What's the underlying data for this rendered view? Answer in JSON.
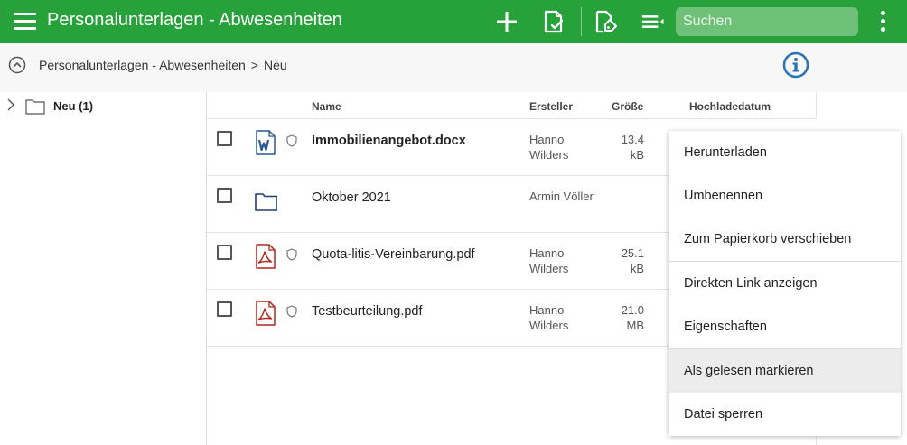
{
  "header": {
    "title": "Personalunterlagen - Abwesenheiten",
    "search_placeholder": "Suchen",
    "icons": [
      "menu-icon",
      "add-icon",
      "document-check-icon",
      "tag-edit-icon",
      "sort-list-icon",
      "more-vert-icon"
    ],
    "brand_color": "#27a13a"
  },
  "breadcrumb": {
    "root": "Personalunterlagen - Abwesenheiten",
    "separator": ">",
    "current": "Neu"
  },
  "tree": {
    "items": [
      {
        "label": "Neu (1)"
      }
    ]
  },
  "table": {
    "columns": {
      "name": "Name",
      "creator": "Ersteller",
      "size": "Größe",
      "uploaded": "Hochladedatum"
    },
    "rows": [
      {
        "type": "word-file-icon",
        "name": "Immobilienangebot.docx",
        "bold": true,
        "creator_first": "Hanno",
        "creator_last": "Wilders",
        "size_value": "13.4",
        "size_unit": "kB"
      },
      {
        "type": "folder-icon",
        "name": "Oktober 2021",
        "bold": false,
        "creator_first": "Armin Völler",
        "creator_last": "",
        "size_value": "",
        "size_unit": ""
      },
      {
        "type": "pdf-file-icon",
        "name": "Quota-litis-Vereinbarung.pdf",
        "bold": false,
        "creator_first": "Hanno",
        "creator_last": "Wilders",
        "size_value": "25.1",
        "size_unit": "kB"
      },
      {
        "type": "pdf-file-icon",
        "name": "Testbeurteilung.pdf",
        "bold": false,
        "creator_first": "Hanno",
        "creator_last": "Wilders",
        "size_value": "21.0",
        "size_unit": "MB"
      }
    ]
  },
  "context_menu": {
    "items": [
      {
        "label": "Herunterladen"
      },
      {
        "label": "Umbenennen"
      },
      {
        "label": "Zum Papierkorb verschieben"
      },
      {
        "label": "Direkten Link anzeigen"
      },
      {
        "label": "Eigenschaften"
      },
      {
        "label": "Als gelesen markieren"
      },
      {
        "label": "Datei sperren"
      }
    ]
  }
}
